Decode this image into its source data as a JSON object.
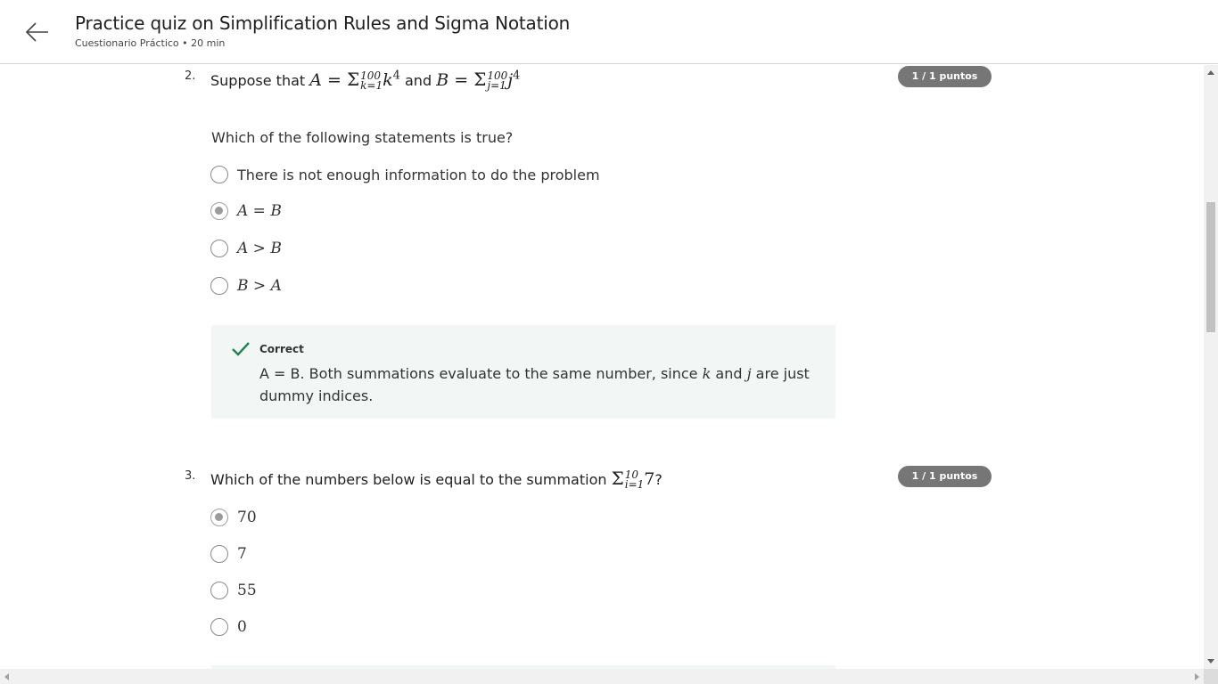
{
  "header": {
    "title": "Practice quiz on Simplification Rules and Sigma Notation",
    "subtitle": "Cuestionario Práctico • 20 min"
  },
  "q2": {
    "number": "2.",
    "text_prefix": "Suppose that",
    "text_and": "and",
    "score": "1 / 1 puntos",
    "prompt": "Which of the following statements is true?",
    "options": [
      {
        "label": "There is not enough information to do the problem",
        "checked": false
      },
      {
        "label": "A = B",
        "checked": true
      },
      {
        "label": "A > B",
        "checked": false
      },
      {
        "label": "B > A",
        "checked": false
      }
    ],
    "feedback": {
      "title": "Correct",
      "text_1": "A = B. Both summations evaluate to the same number, since",
      "var_k": "k",
      "text_and": "and",
      "var_j": "j",
      "text_2": "are just dummy indices."
    }
  },
  "q3": {
    "number": "3.",
    "text": "Which of the numbers below is equal to the summation",
    "text_end": "?",
    "score": "1 / 1 puntos",
    "options": [
      {
        "label": "70",
        "checked": true
      },
      {
        "label": "7",
        "checked": false
      },
      {
        "label": "55",
        "checked": false
      },
      {
        "label": "0",
        "checked": false
      }
    ]
  },
  "colors": {
    "accent_green": "#1f8354",
    "badge_gray": "#767676",
    "feedback_bg": "#f2f7f5"
  }
}
